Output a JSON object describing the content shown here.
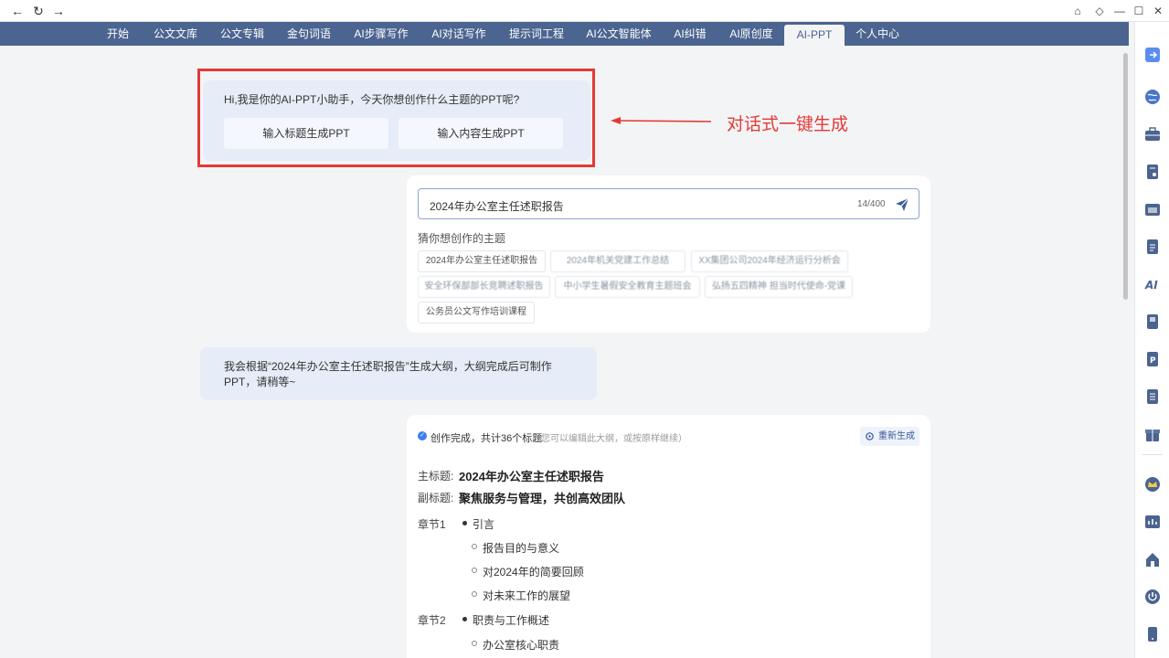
{
  "browser": {
    "back": "←",
    "reload": "↻",
    "forward": "→",
    "home": "⌂",
    "extension": "◇",
    "minimize": "—",
    "maximize": "☐",
    "close": "✕"
  },
  "nav": {
    "tabs": [
      "开始",
      "公文文库",
      "公文专辑",
      "金句词语",
      "AI步骤写作",
      "AI对话写作",
      "提示词工程",
      "AI公文智能体",
      "AI纠错",
      "AI原创度",
      "AI-PPT",
      "个人中心"
    ],
    "active": "AI-PPT"
  },
  "greeting": {
    "text": "Hi,我是你的AI-PPT小助手，今天你想创作什么主题的PPT呢?",
    "btn_title": "输入标题生成PPT",
    "btn_content": "输入内容生成PPT"
  },
  "annotation": {
    "label": "对话式一键生成",
    "color": "#e53935"
  },
  "input": {
    "value": "2024年办公室主任述职报告",
    "count": "14/400",
    "guess_title": "猜你想创作的主题",
    "chips": [
      "2024年办公室主任述职报告",
      "2024年机关党建工作总结",
      "XX集团公司2024年经济运行分析会",
      "安全环保部部长竞聘述职报告",
      "中小学生暑假安全教育主题班会",
      "弘扬五四精神 担当时代使命-党课",
      "公务员公文写作培训课程"
    ]
  },
  "reply": {
    "text": "我会根据“2024年办公室主任述职报告”生成大纲，大纲完成后可制作PPT，请稍等~"
  },
  "outline": {
    "status": "创作完成，共计36个标题",
    "hint": "（您可以编辑此大纲，或按原样继续）",
    "regen": "重新生成",
    "main_label": "主标题:",
    "main_title": "2024年办公室主任述职报告",
    "sub_label": "副标题:",
    "sub_title": "聚焦服务与管理，共创高效团队",
    "chapters": [
      {
        "label": "章节1",
        "title": "引言",
        "items": [
          "报告目的与意义",
          "对2024年的简要回顾",
          "对未来工作的展望"
        ]
      },
      {
        "label": "章节2",
        "title": "职责与工作概述",
        "items": [
          "办公室核心职责"
        ]
      }
    ]
  },
  "colors": {
    "nav": "#4b6490",
    "accent": "#3d7ef0",
    "bubble": "#e6ecf8"
  },
  "sidebar_icons": [
    "login-icon",
    "globe-icon",
    "toolbox-icon",
    "doc-icon",
    "template-icon",
    "write-icon",
    "ai-icon",
    "book-icon",
    "ppt-icon",
    "list-icon",
    "gift-icon",
    "crown-icon",
    "chart-icon",
    "home-icon",
    "power-icon",
    "phone-icon"
  ]
}
